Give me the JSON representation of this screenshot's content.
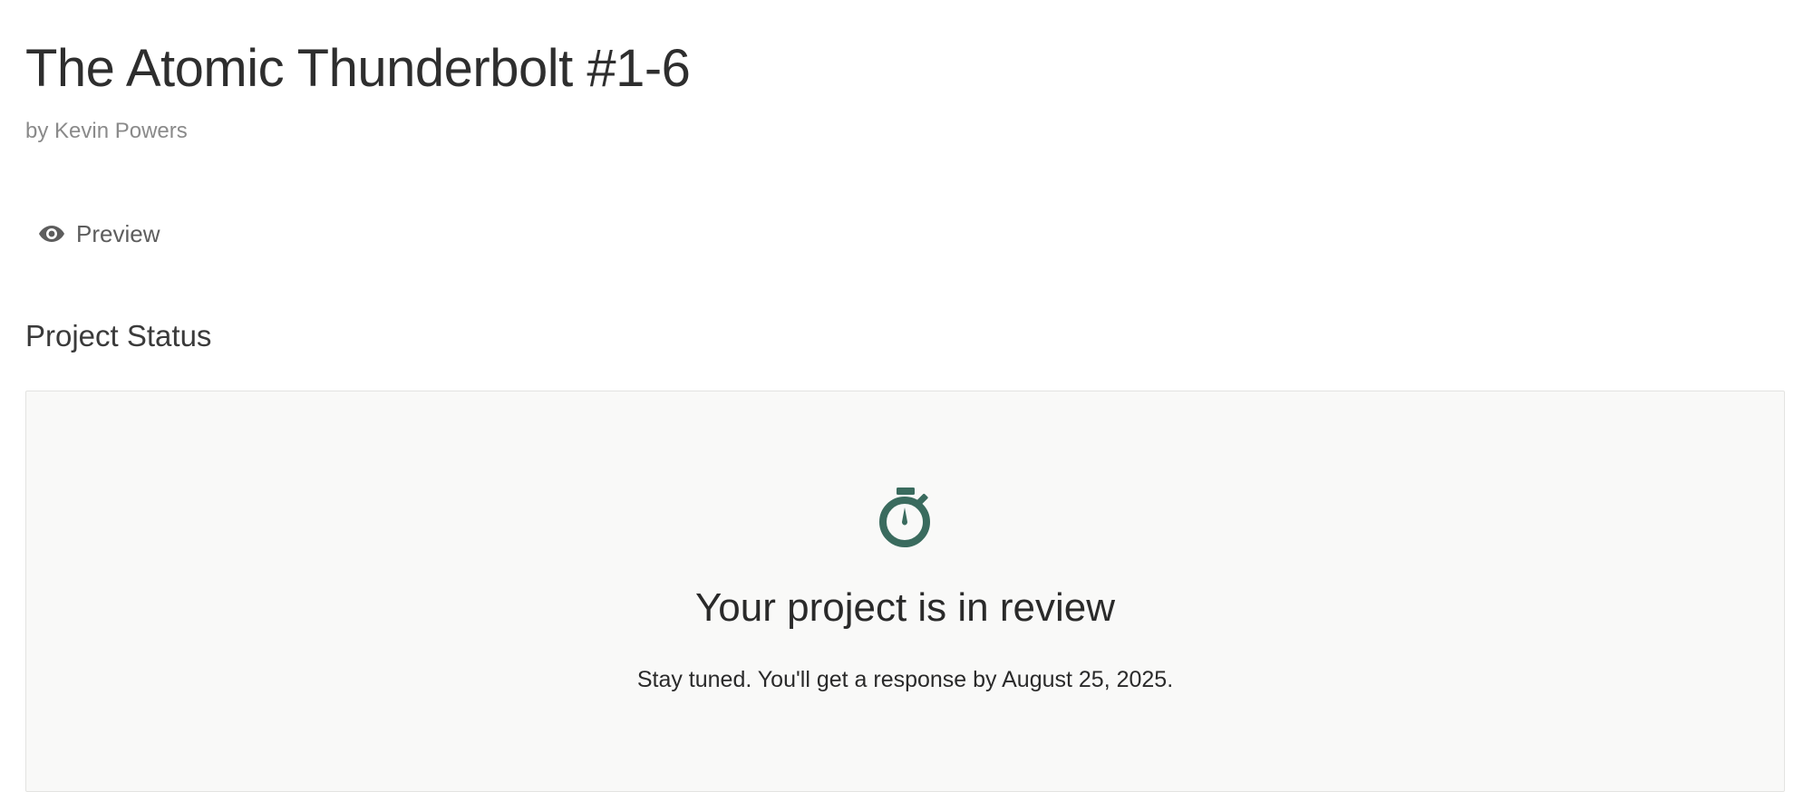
{
  "project": {
    "title": "The Atomic Thunderbolt #1-6",
    "author": "by Kevin Powers"
  },
  "actions": {
    "preview_label": "Preview",
    "preview_icon": "eye-icon"
  },
  "status_section": {
    "title": "Project Status",
    "icon": "stopwatch-icon",
    "icon_color": "#3a6b5e",
    "heading": "Your project is in review",
    "message": "Stay tuned. You'll get a response by August 25, 2025."
  }
}
